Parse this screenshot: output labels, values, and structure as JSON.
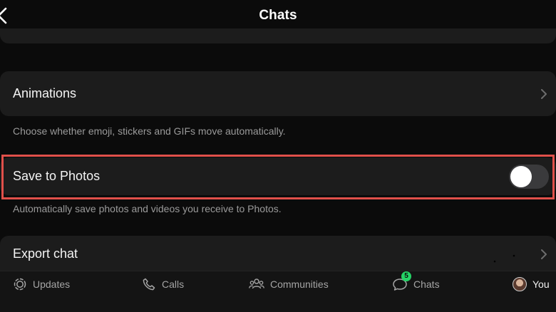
{
  "header": {
    "title": "Chats",
    "back_icon": "chevron-left-icon"
  },
  "settings": {
    "animations": {
      "label": "Animations",
      "description": "Choose whether emoji, stickers and GIFs move automatically."
    },
    "save_to_photos": {
      "label": "Save to Photos",
      "toggle_on": false,
      "description": "Automatically save photos and videos you receive to Photos."
    },
    "export_chat": {
      "label": "Export chat"
    }
  },
  "tabbar": {
    "updates": "Updates",
    "calls": "Calls",
    "communities": "Communities",
    "chats": "Chats",
    "chats_badge": "5",
    "you": "You"
  },
  "colors": {
    "background": "#0b0b0b",
    "card": "#1c1c1c",
    "highlight": "#e0504a",
    "badge": "#25d366"
  }
}
